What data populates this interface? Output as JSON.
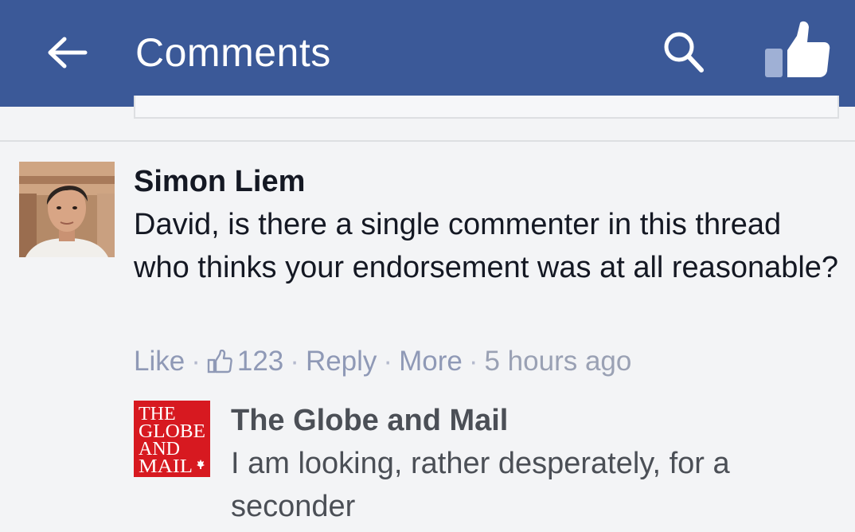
{
  "header": {
    "title": "Comments",
    "back_icon": "arrow-left-icon",
    "search_icon": "search-icon",
    "like_icon": "thumbs-up-icon",
    "bar_color": "#3b5998"
  },
  "comment": {
    "author": "Simon Liem",
    "text": "David, is there a single commenter in this thread who thinks your endorsement was at all reasonable?",
    "actions": {
      "like": "Like",
      "like_count": "123",
      "reply": "Reply",
      "more": "More",
      "timestamp": "5 hours ago",
      "separator": "·"
    }
  },
  "reply": {
    "logo_text": [
      "THE",
      "GLOBE",
      "AND",
      "MAIL"
    ],
    "logo_color": "#d71920",
    "author": "The Globe and Mail",
    "text": "I am looking, rather desperately, for a seconder"
  }
}
